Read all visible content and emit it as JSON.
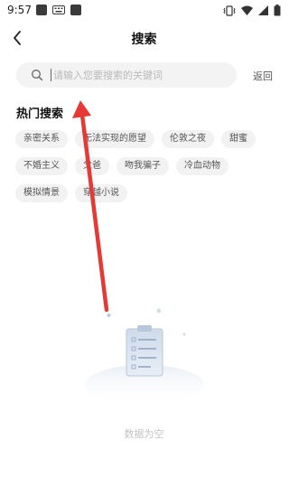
{
  "status_bar": {
    "time": "9:57"
  },
  "header": {
    "title": "搜索"
  },
  "search": {
    "placeholder": "请输入您要搜索的关键词",
    "value": "",
    "return_label": "返回"
  },
  "hot_search": {
    "title": "热门搜索",
    "rows": [
      [
        "亲密关系",
        "无法实现的愿望",
        "伦敦之夜",
        "甜蜜"
      ],
      [
        "不婚主义",
        "父爸",
        "吻我骗子",
        "冷血动物"
      ],
      [
        "模拟情景",
        "穿越小说"
      ]
    ]
  },
  "empty_state": {
    "text": "数据为空"
  },
  "colors": {
    "annotation_arrow": "#e53935",
    "search_bg": "#f3f3f3",
    "tag_bg": "#f2f2f2"
  }
}
